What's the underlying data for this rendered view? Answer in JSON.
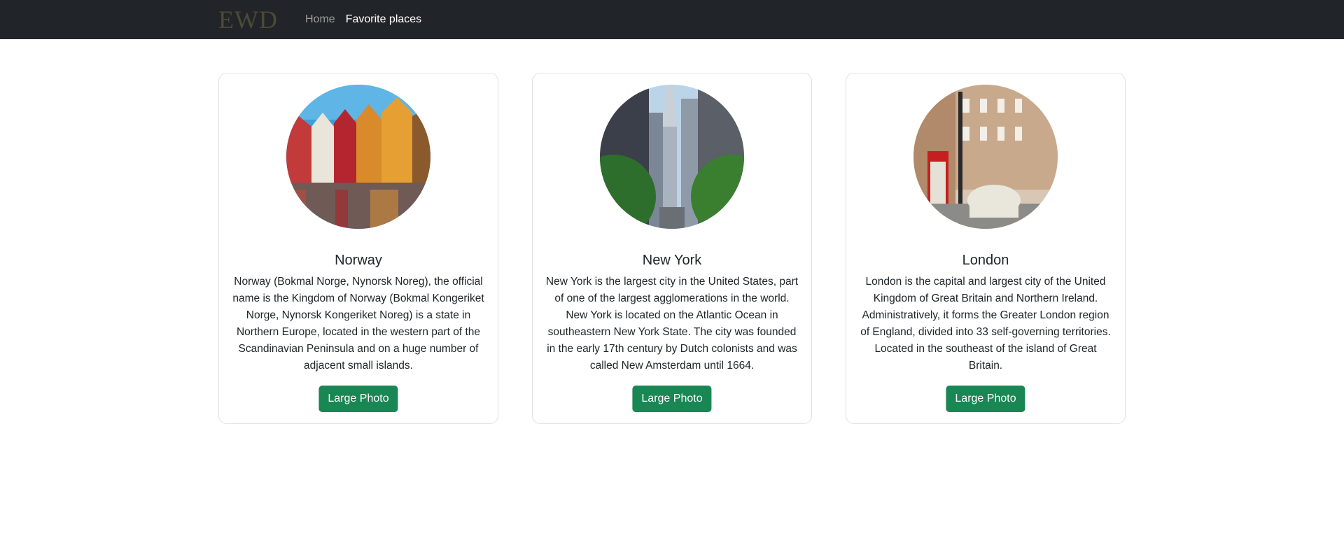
{
  "navbar": {
    "brand": "EWD",
    "links": [
      {
        "label": "Home"
      },
      {
        "label": "Favorite places"
      }
    ]
  },
  "cards": [
    {
      "title": "Norway",
      "text": "Norway (Bokmal Norge, Nynorsk Noreg), the official name is the Kingdom of Norway (Bokmal Kongeriket Norge, Nynorsk Kongeriket Noreg) is a state in Northern Europe, located in the western part of the Scandinavian Peninsula and on a huge number of adjacent small islands.",
      "button": "Large Photo"
    },
    {
      "title": "New York",
      "text": "New York is the largest city in the United States, part of one of the largest agglomerations in the world. New York is located on the Atlantic Ocean in southeastern New York State. The city was founded in the early 17th century by Dutch colonists and was called New Amsterdam until 1664.",
      "button": "Large Photo"
    },
    {
      "title": "London",
      "text": "London is the capital and largest city of the United Kingdom of Great Britain and Northern Ireland. Administratively, it forms the Greater London region of England, divided into 33 self-governing territories. Located in the southeast of the island of Great Britain.",
      "button": "Large Photo"
    }
  ],
  "colors": {
    "navbar_bg": "#212529",
    "button_bg": "#198754",
    "card_border": "#dee2e6"
  }
}
